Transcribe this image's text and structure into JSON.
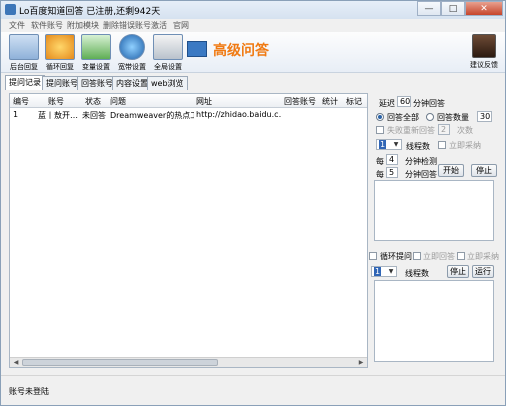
{
  "window": {
    "title": "Lo百度知道回答  已注册,还剩942天",
    "minimize": "—",
    "maximize": "□",
    "close": "✕"
  },
  "menu": [
    "文件",
    "软件账号",
    "附加模块",
    "删除错误账号",
    "激活",
    "官网"
  ],
  "toolbar": {
    "buttons": [
      {
        "label": "后台回复",
        "icon": "monitor-icon"
      },
      {
        "label": "循环回复",
        "icon": "cycle-icon"
      },
      {
        "label": "变量设置",
        "icon": "network-icon"
      },
      {
        "label": "宽带设置",
        "icon": "globe-icon"
      },
      {
        "label": "全局设置",
        "icon": "tools-icon"
      }
    ],
    "advanced_title": "高级问答",
    "feedback_label": "建议反馈"
  },
  "tabs": [
    "提问记录",
    "提问账号",
    "回答账号",
    "内容设置",
    "web浏览"
  ],
  "table": {
    "columns": [
      "编号",
      "账号",
      "状态",
      "问题",
      "网址",
      "回答账号",
      "统计",
      "标记"
    ],
    "rows": [
      [
        "1",
        "蓝丨敖开…",
        "未回答",
        "Dreamweaver的热点工…",
        "http://zhidao.baidu.c…",
        "",
        "",
        ""
      ]
    ]
  },
  "panel": {
    "delay_prefix": "延迟",
    "delay_value": "60",
    "delay_suffix": "分钟回答",
    "answer_all_label": "回答全部",
    "answer_count_label": "回答数量",
    "answer_count_value": "30",
    "retry_fail_label": "失败重新回答",
    "retry_count_value": "2",
    "retry_suffix": "次数",
    "threads_value": "1",
    "threads_label": "线程数",
    "select_adopt_label": "立即采纳",
    "every_label_1": "每",
    "check_value": "4",
    "check_suffix": "分钟检测",
    "every_label_2": "每",
    "answer_every_value": "5",
    "answer_every_suffix": "分钟回答",
    "start_button": "开始",
    "stop_button": "停止"
  },
  "panel2": {
    "loop_ask_label": "循环提问",
    "immediate_answer_label": "立即回答",
    "immediate_adopt_label": "立即采纳",
    "threads_value": "1",
    "threads_label": "线程数",
    "stop_button": "停止",
    "run_button": "运行"
  },
  "status": {
    "text": "账号未登陆"
  }
}
